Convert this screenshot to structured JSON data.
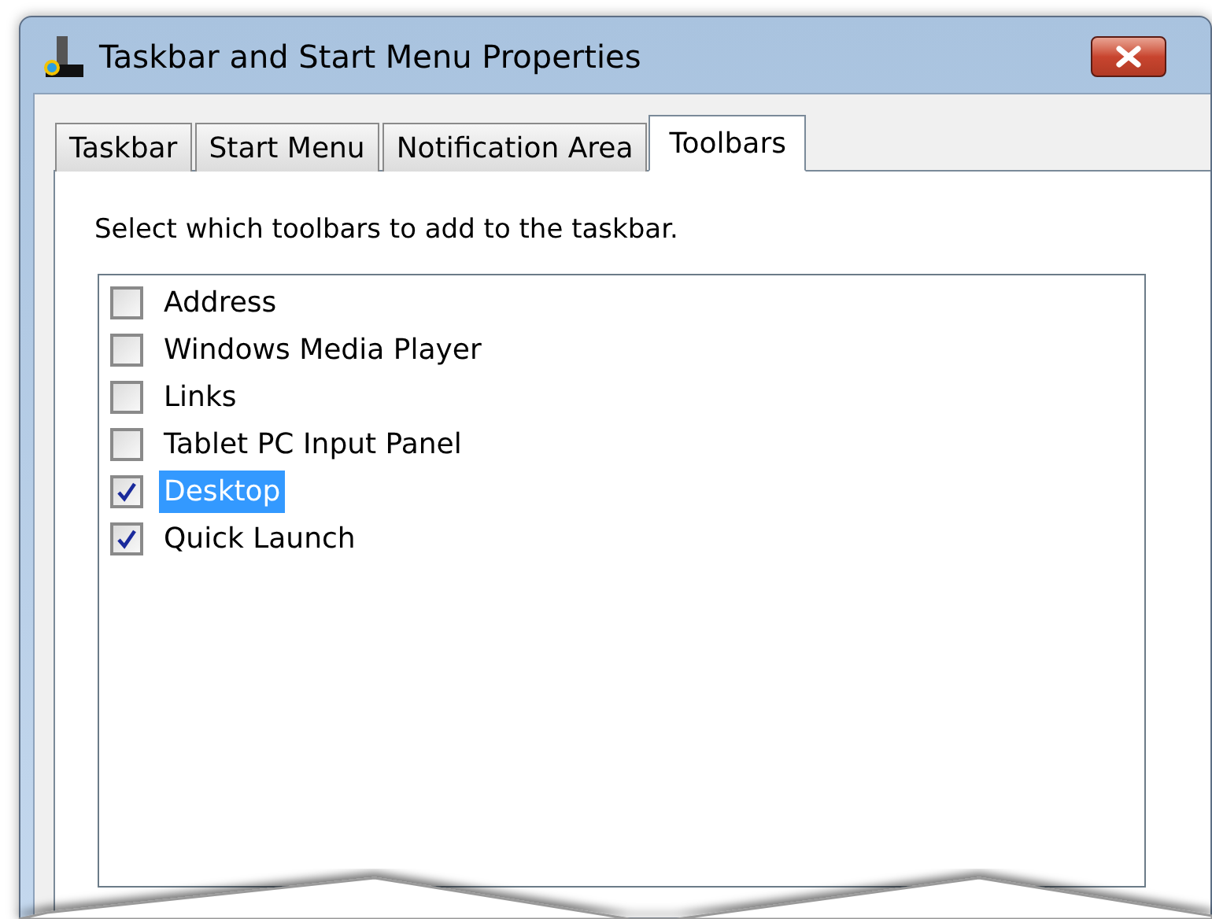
{
  "window": {
    "title": "Taskbar and Start Menu Properties"
  },
  "tabs": [
    {
      "label": "Taskbar",
      "selected": false
    },
    {
      "label": "Start Menu",
      "selected": false
    },
    {
      "label": "Notification Area",
      "selected": false
    },
    {
      "label": "Toolbars",
      "selected": true
    }
  ],
  "instruction": "Select which toolbars to add to the taskbar.",
  "toolbars": [
    {
      "label": "Address",
      "checked": false,
      "selected": false
    },
    {
      "label": "Windows Media Player",
      "checked": false,
      "selected": false
    },
    {
      "label": "Links",
      "checked": false,
      "selected": false
    },
    {
      "label": "Tablet PC Input Panel",
      "checked": false,
      "selected": false
    },
    {
      "label": "Desktop",
      "checked": true,
      "selected": true
    },
    {
      "label": "Quick Launch",
      "checked": true,
      "selected": false
    }
  ]
}
